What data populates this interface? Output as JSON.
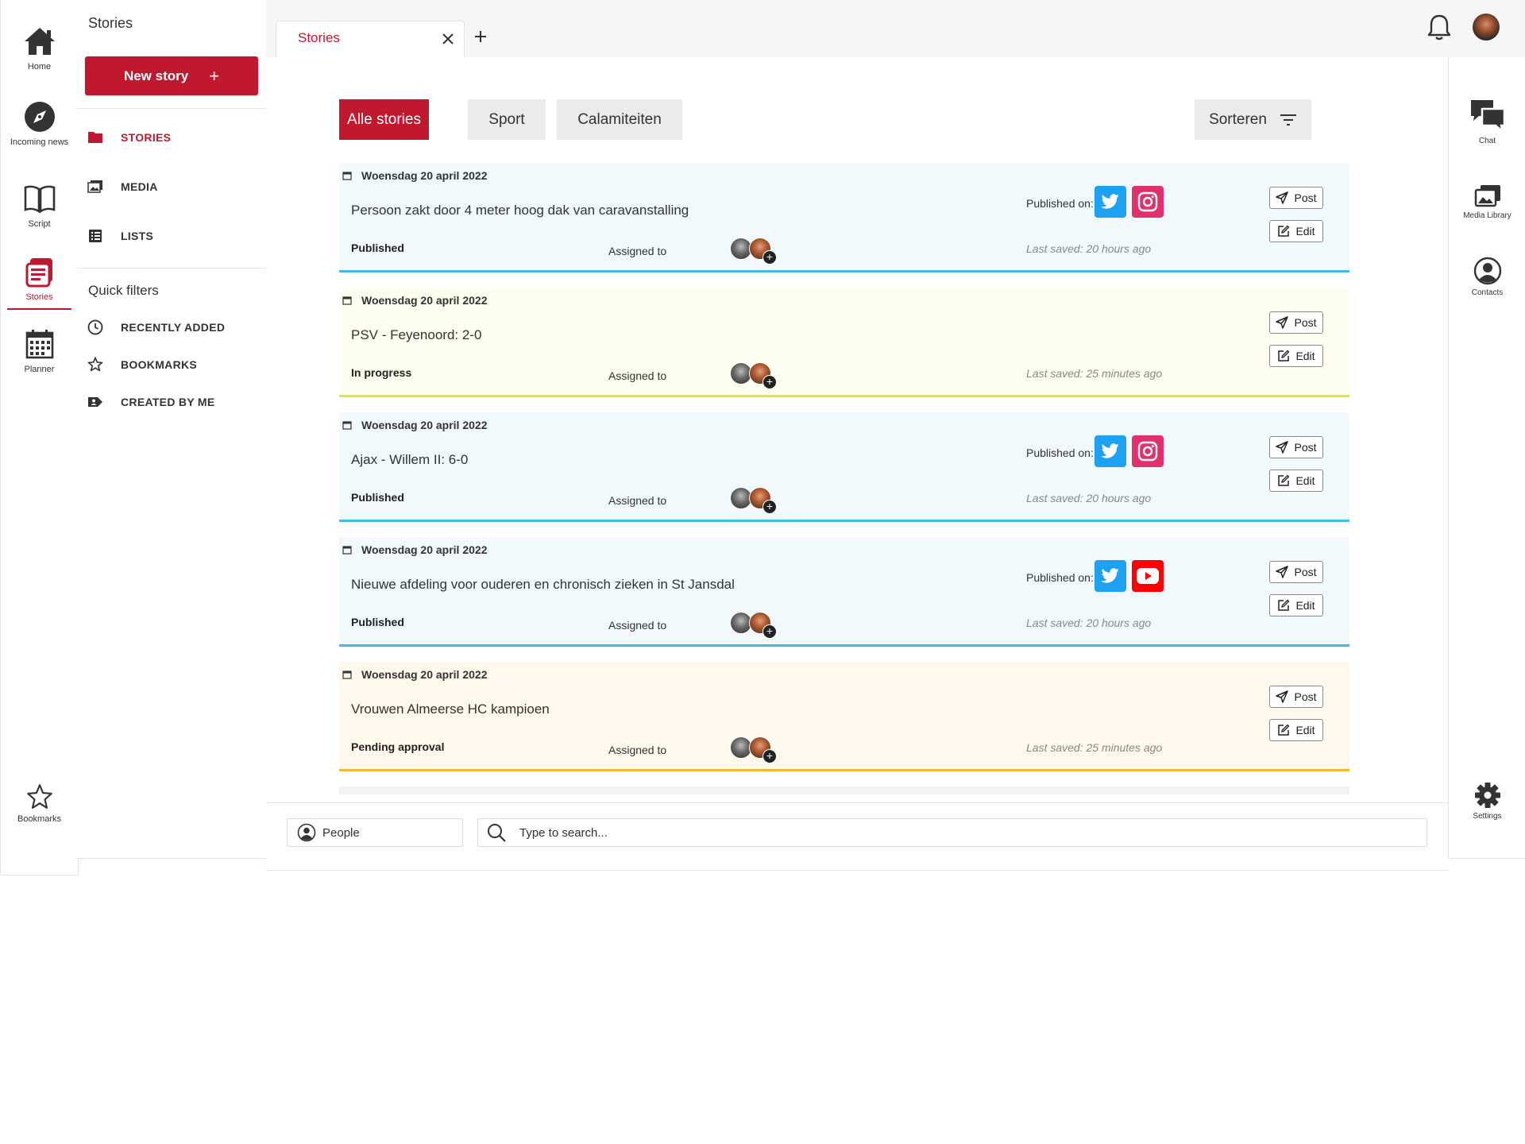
{
  "rail": {
    "items": [
      {
        "label": "Home",
        "icon": "home-icon"
      },
      {
        "label": "Incoming news",
        "icon": "compass-icon"
      },
      {
        "label": "Script",
        "icon": "book-icon"
      },
      {
        "label": "Stories",
        "icon": "newspaper-icon",
        "active": true
      },
      {
        "label": "Planner",
        "icon": "calendar-icon"
      }
    ],
    "bottom": {
      "label": "Bookmarks",
      "icon": "star-icon"
    }
  },
  "sidebar": {
    "title": "Stories",
    "new_story_label": "New story",
    "new_story_plus": "+",
    "nav": [
      {
        "label": "STORIES",
        "icon": "folder-icon",
        "active": true
      },
      {
        "label": "MEDIA",
        "icon": "images-icon"
      },
      {
        "label": "LISTS",
        "icon": "list-icon"
      }
    ],
    "quick_filters_title": "Quick filters",
    "quick_filters": [
      {
        "label": "RECENTLY ADDED",
        "icon": "clock-icon"
      },
      {
        "label": "BOOKMARKS",
        "icon": "star-icon"
      },
      {
        "label": "CREATED BY ME",
        "icon": "user-tag-icon"
      }
    ]
  },
  "tabs": {
    "open": [
      {
        "label": "Stories"
      }
    ],
    "add_label": "+"
  },
  "filters": {
    "items": [
      "Alle stories",
      "Sport",
      "Calamiteiten"
    ],
    "active_index": 0,
    "sort_label": "Sorteren"
  },
  "stories": [
    {
      "date": "Woensdag 20 april 2022",
      "headline": "Persoon zakt door 4 meter hoog dak van caravanstalling",
      "status": "Published",
      "assigned_label": "Assigned to",
      "published_on_label": "Published on:",
      "platforms": [
        "twitter",
        "instagram"
      ],
      "last_saved": "Last saved:  20 hours ago",
      "post_label": "Post",
      "edit_label": "Edit"
    },
    {
      "date": "Woensdag 20 april 2022",
      "headline": "PSV - Feyenoord:   2-0",
      "status": "In progress",
      "assigned_label": "Assigned to",
      "published_on_label": "",
      "platforms": [],
      "last_saved": "Last saved:  25 minutes ago",
      "post_label": "Post",
      "edit_label": "Edit"
    },
    {
      "date": "Woensdag 20 april 2022",
      "headline": "Ajax - Willem II:   6-0",
      "status": "Published",
      "assigned_label": "Assigned to",
      "published_on_label": "Published on:",
      "platforms": [
        "twitter",
        "instagram"
      ],
      "last_saved": "Last saved:  20 hours ago",
      "post_label": "Post",
      "edit_label": "Edit"
    },
    {
      "date": "Woensdag 20 april 2022",
      "headline": "Nieuwe afdeling voor ouderen en chronisch zieken in St Jansdal",
      "status": "Published",
      "assigned_label": "Assigned to",
      "published_on_label": "Published on:",
      "platforms": [
        "twitter",
        "youtube"
      ],
      "last_saved": "Last saved:  20 hours ago",
      "post_label": "Post",
      "edit_label": "Edit"
    },
    {
      "date": "Woensdag 20 april 2022",
      "headline": "Vrouwen Almeerse HC kampioen",
      "status": "Pending approval",
      "assigned_label": "Assigned to",
      "published_on_label": "",
      "platforms": [],
      "last_saved": "Last saved:  25 minutes ago",
      "post_label": "Post",
      "edit_label": "Edit"
    }
  ],
  "right_rail": {
    "items": [
      {
        "label": "Chat",
        "icon": "chat-icon"
      },
      {
        "label": "Media Library",
        "icon": "images-icon"
      },
      {
        "label": "Contacts",
        "icon": "person-circle-icon"
      }
    ],
    "bottom": {
      "label": "Settings",
      "icon": "gear-icon"
    }
  },
  "bottom_bar": {
    "people_label": "People",
    "search_placeholder": "Type to search..."
  },
  "colors": {
    "accent": "#c0182f",
    "published": "#3fbde6",
    "in_progress": "#f0e330",
    "pending": "#f1b930"
  }
}
